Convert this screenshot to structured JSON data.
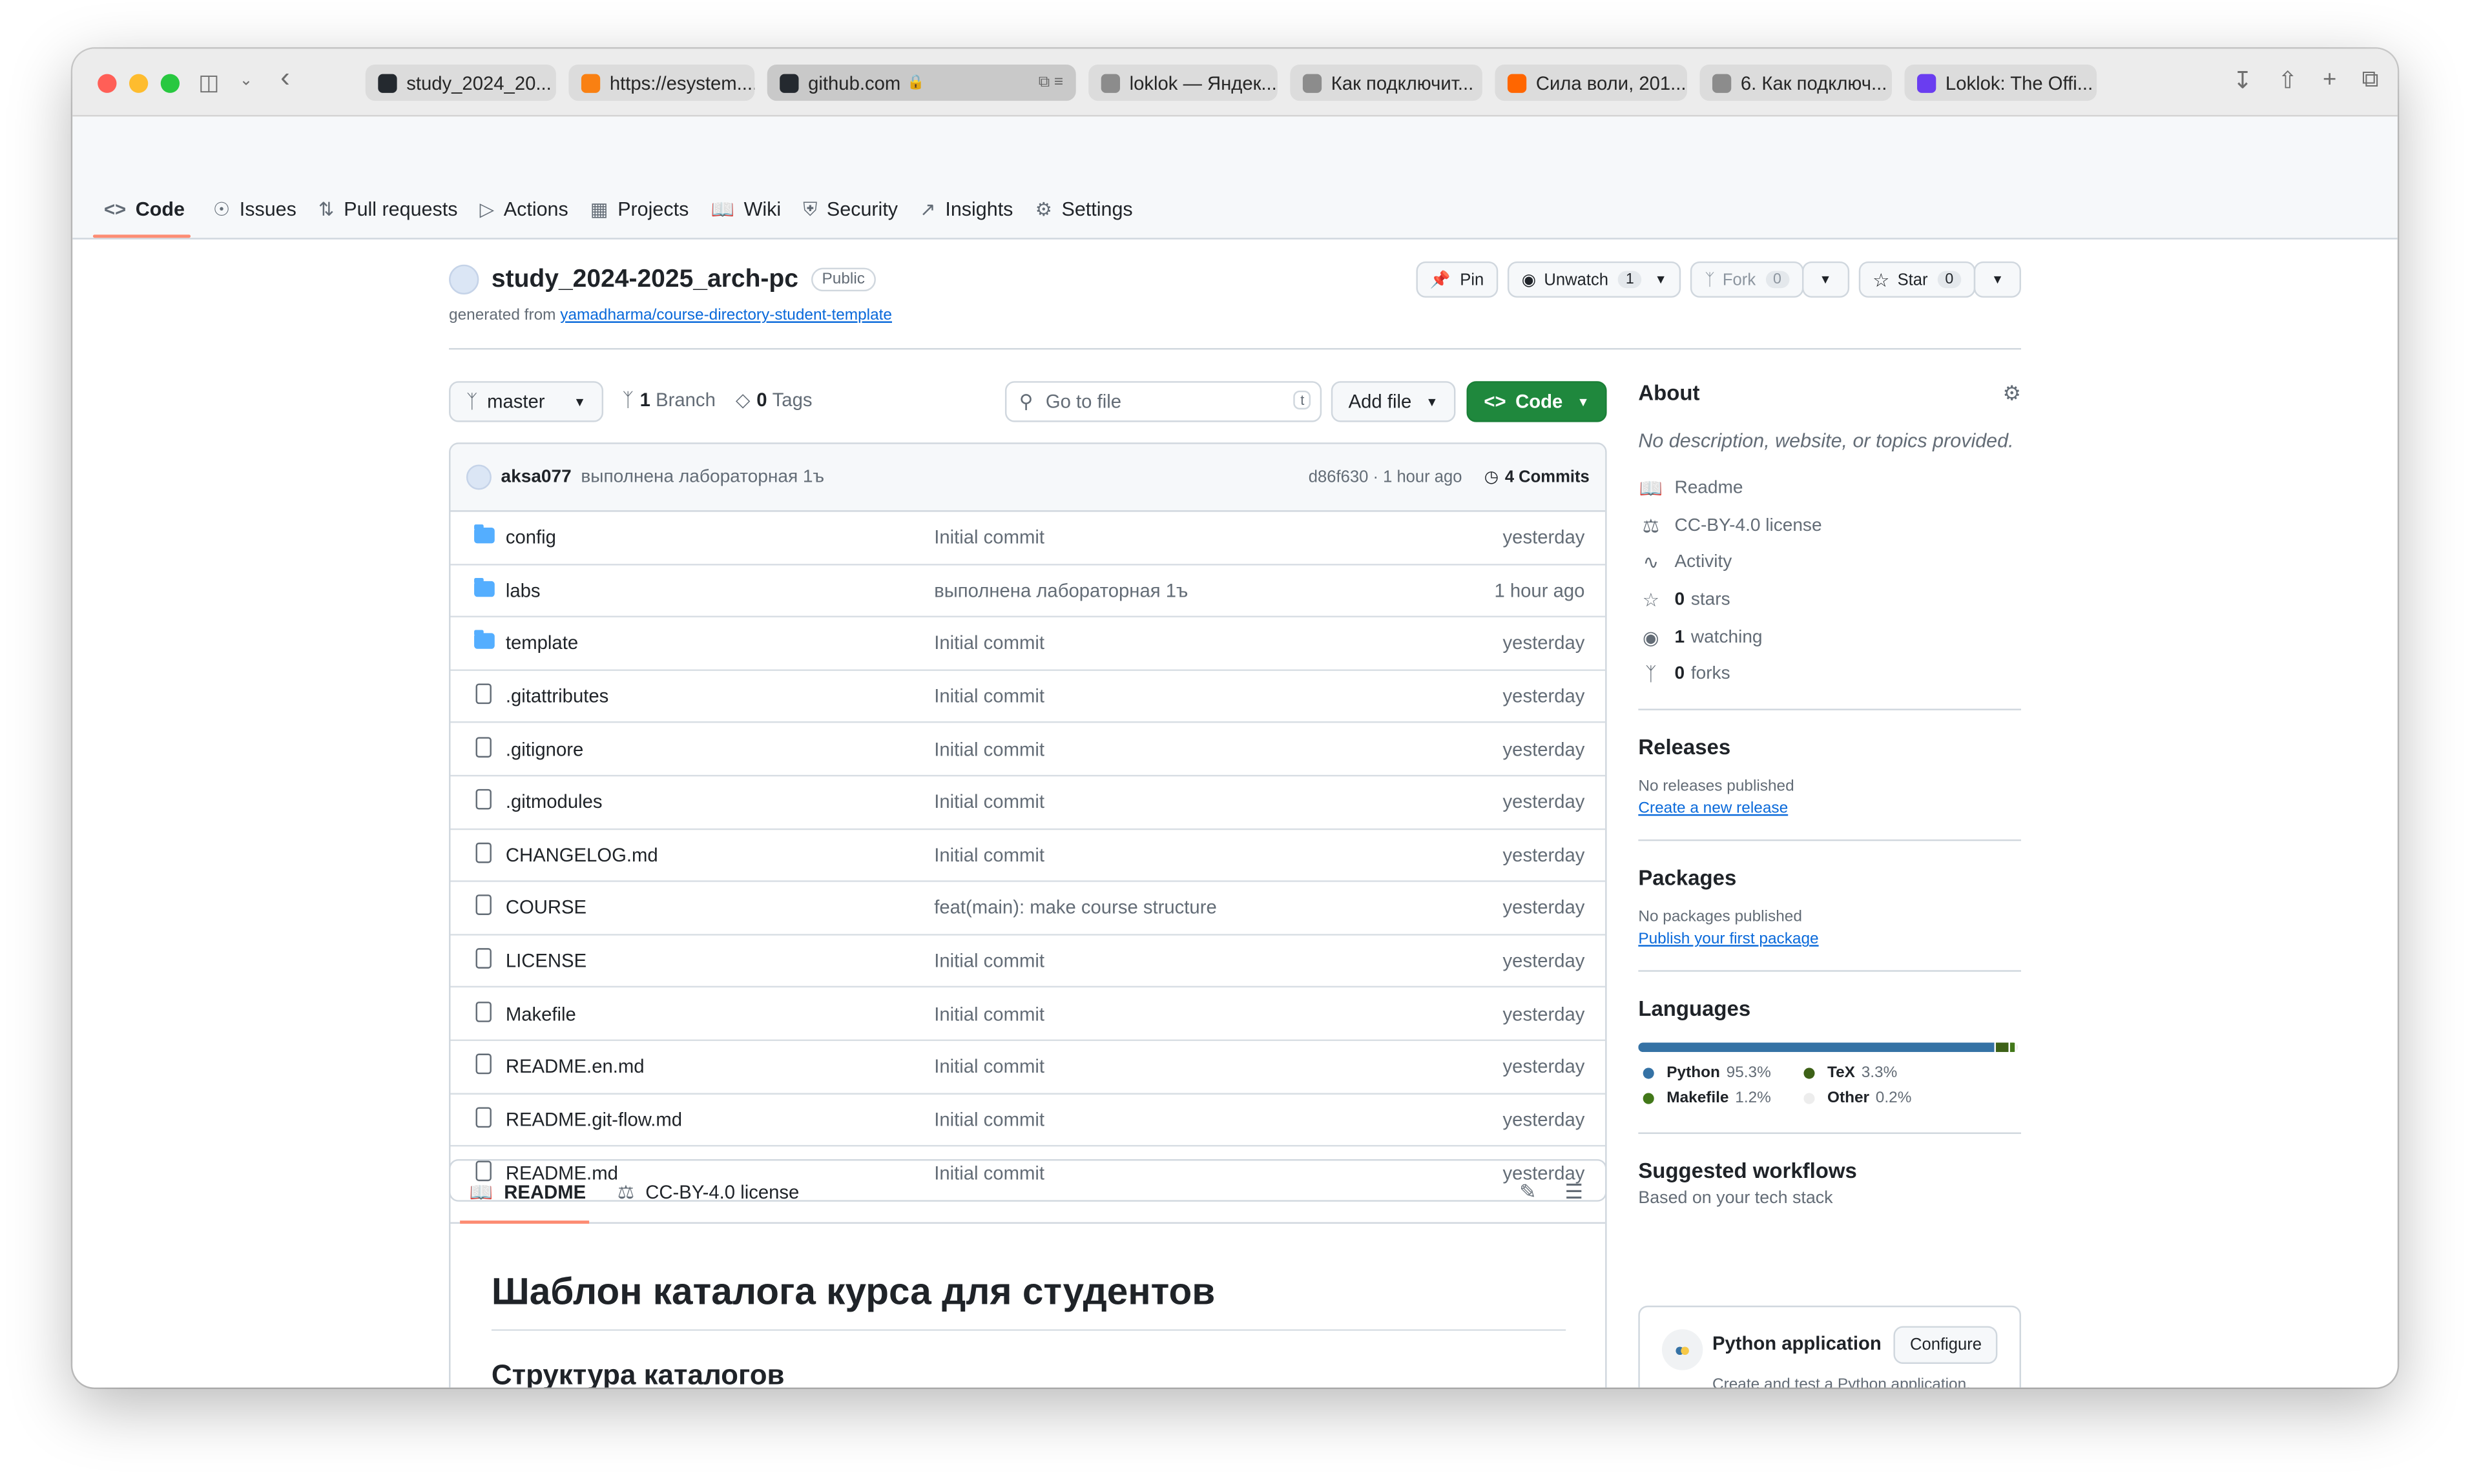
{
  "browser": {
    "tabs": [
      {
        "label": "study_2024_20...",
        "icon": "github-icon",
        "color": "#24292f"
      },
      {
        "label": "https://esystem....",
        "icon": "moodle-icon",
        "color": "#f98012"
      },
      {
        "label": "github.com",
        "icon": "github-icon",
        "color": "#24292f",
        "active": true
      },
      {
        "label": "loklok — Яндек...",
        "icon": "yandex-icon",
        "color": "#8c8c8c"
      },
      {
        "label": "Как подключит...",
        "icon": "yandex-icon",
        "color": "#8c8c8c"
      },
      {
        "label": "Сила воли, 201...",
        "icon": "kinopoisk-icon",
        "color": "#ff6600"
      },
      {
        "label": "6. Как подключ...",
        "icon": "yandex-icon",
        "color": "#8c8c8c"
      },
      {
        "label": "Loklok: The Offi...",
        "icon": "loklok-icon",
        "color": "#6a3df0"
      }
    ]
  },
  "repo_nav": {
    "items": [
      {
        "label": "Code",
        "icon": "code-icon",
        "selected": true
      },
      {
        "label": "Issues",
        "icon": "issue-icon"
      },
      {
        "label": "Pull requests",
        "icon": "pull-request-icon"
      },
      {
        "label": "Actions",
        "icon": "play-icon"
      },
      {
        "label": "Projects",
        "icon": "table-icon"
      },
      {
        "label": "Wiki",
        "icon": "book-icon"
      },
      {
        "label": "Security",
        "icon": "shield-icon"
      },
      {
        "label": "Insights",
        "icon": "graph-icon"
      },
      {
        "label": "Settings",
        "icon": "gear-icon"
      }
    ]
  },
  "repo": {
    "name": "study_2024-2025_arch-pc",
    "visibility": "Public",
    "generated_prefix": "generated from",
    "generated_from": "yamadharma/course-directory-student-template",
    "pin_label": "Pin",
    "unwatch_label": "Unwatch",
    "watch_count": "1",
    "fork_label": "Fork",
    "fork_count": "0",
    "star_label": "Star",
    "star_count": "0"
  },
  "toolbar": {
    "branch": "master",
    "branch_count": "1",
    "branch_word": "Branch",
    "tag_count": "0",
    "tag_word": "Tags",
    "go_to_file_placeholder": "Go to file",
    "go_to_file_key": "t",
    "add_file_label": "Add file",
    "code_label": "Code"
  },
  "commit": {
    "author": "aksa077",
    "message": "выполнена лабораторная 1ъ",
    "hash_time": "d86f630 · 1 hour ago",
    "commits_label": "4 Commits"
  },
  "files": [
    {
      "type": "dir",
      "name": "config",
      "message": "Initial commit",
      "time": "yesterday"
    },
    {
      "type": "dir",
      "name": "labs",
      "message": "выполнена лабораторная 1ъ",
      "time": "1 hour ago"
    },
    {
      "type": "dir",
      "name": "template",
      "message": "Initial commit",
      "time": "yesterday"
    },
    {
      "type": "file",
      "name": ".gitattributes",
      "message": "Initial commit",
      "time": "yesterday"
    },
    {
      "type": "file",
      "name": ".gitignore",
      "message": "Initial commit",
      "time": "yesterday"
    },
    {
      "type": "file",
      "name": ".gitmodules",
      "message": "Initial commit",
      "time": "yesterday"
    },
    {
      "type": "file",
      "name": "CHANGELOG.md",
      "message": "Initial commit",
      "time": "yesterday"
    },
    {
      "type": "file",
      "name": "COURSE",
      "message": "feat(main): make course structure",
      "time": "yesterday"
    },
    {
      "type": "file",
      "name": "LICENSE",
      "message": "Initial commit",
      "time": "yesterday"
    },
    {
      "type": "file",
      "name": "Makefile",
      "message": "Initial commit",
      "time": "yesterday"
    },
    {
      "type": "file",
      "name": "README.en.md",
      "message": "Initial commit",
      "time": "yesterday"
    },
    {
      "type": "file",
      "name": "README.git-flow.md",
      "message": "Initial commit",
      "time": "yesterday"
    },
    {
      "type": "file",
      "name": "README.md",
      "message": "Initial commit",
      "time": "yesterday"
    }
  ],
  "readme": {
    "tab_readme": "README",
    "tab_license": "CC-BY-4.0 license",
    "heading": "Шаблон каталога курса для студентов",
    "subheading": "Структура каталогов"
  },
  "about": {
    "title": "About",
    "description": "No description, website, or topics provided.",
    "readme": "Readme",
    "license": "CC-BY-4.0 license",
    "activity": "Activity",
    "stars_count": "0",
    "stars_word": "stars",
    "watching_count": "1",
    "watching_word": "watching",
    "forks_count": "0",
    "forks_word": "forks"
  },
  "releases": {
    "title": "Releases",
    "none": "No releases published",
    "create": "Create a new release"
  },
  "packages": {
    "title": "Packages",
    "none": "No packages published",
    "publish": "Publish your first package"
  },
  "languages": {
    "title": "Languages",
    "items": [
      {
        "name": "Python",
        "percent": "95.3%",
        "value": 95.3,
        "color": "#3572A5"
      },
      {
        "name": "TeX",
        "percent": "3.3%",
        "value": 3.3,
        "color": "#3D6117"
      },
      {
        "name": "Makefile",
        "percent": "1.2%",
        "value": 1.2,
        "color": "#427819"
      },
      {
        "name": "Other",
        "percent": "0.2%",
        "value": 0.2,
        "color": "#ededed"
      }
    ]
  },
  "workflows": {
    "title": "Suggested workflows",
    "subtitle": "Based on your tech stack",
    "name": "Python application",
    "configure": "Configure",
    "description": "Create and test a Python application."
  }
}
